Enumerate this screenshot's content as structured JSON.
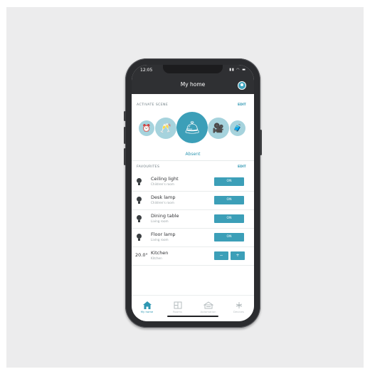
{
  "status_bar": {
    "time": "12:05",
    "icons": "▮▮ ◠ ▬"
  },
  "header": {
    "title": "My home"
  },
  "scenes": {
    "section_label": "ACTIVATE SCENE",
    "edit_label": "EDIT",
    "items": [
      {
        "icon": "alarm-clock-icon",
        "glyph": "⏰"
      },
      {
        "icon": "wine-glasses-icon",
        "glyph": "🥂"
      },
      {
        "icon": "bell-icon",
        "glyph": "🛎"
      },
      {
        "icon": "video-camera-icon",
        "glyph": "🎥"
      },
      {
        "icon": "luggage-icon",
        "glyph": "🧳"
      }
    ],
    "active_label": "Absent"
  },
  "favourites": {
    "section_label": "FAVOURITES",
    "edit_label": "EDIT",
    "items": [
      {
        "name": "Ceiling light",
        "room": "Children's room",
        "action": "ON"
      },
      {
        "name": "Desk lamp",
        "room": "Children's room",
        "action": "ON"
      },
      {
        "name": "Dining table",
        "room": "Living room",
        "action": "ON"
      },
      {
        "name": "Floor lamp",
        "room": "Living room",
        "action": "ON"
      }
    ],
    "thermostat": {
      "name": "Kitchen",
      "room": "Kitchen",
      "value": "20.0°",
      "minus": "−",
      "plus": "+"
    }
  },
  "tabbar": {
    "items": [
      {
        "label": "My home",
        "active": true
      },
      {
        "label": "Rooms",
        "active": false
      },
      {
        "label": "Automation",
        "active": false
      },
      {
        "label": "Devices",
        "active": false
      }
    ]
  },
  "colors": {
    "accent": "#3c9fb8",
    "accent_light": "#a6d3dd",
    "header": "#2f3033"
  }
}
